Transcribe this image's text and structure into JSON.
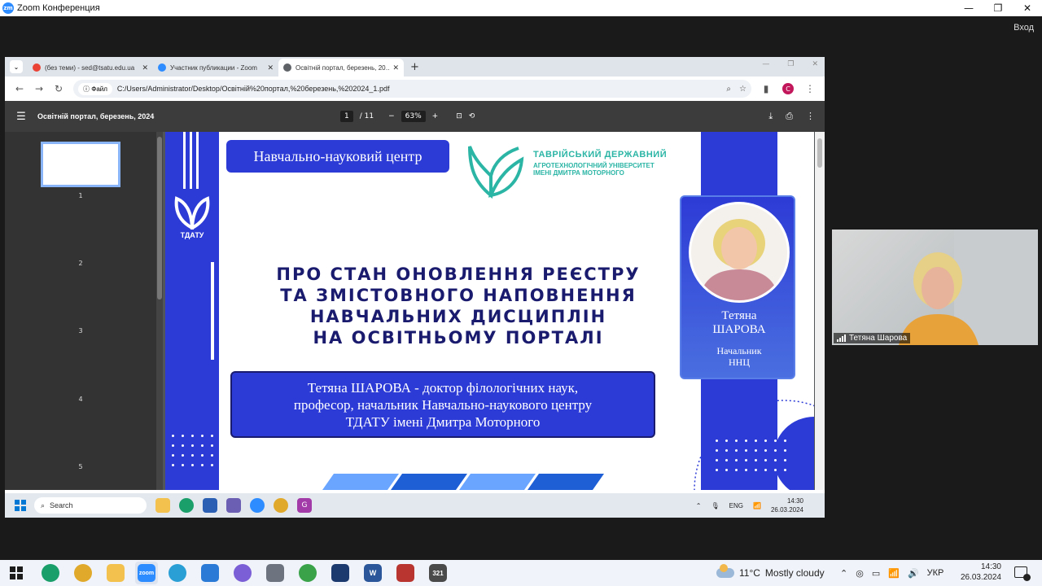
{
  "zoom": {
    "title": "Zoom Конференция",
    "logo": "zm",
    "login_label": "Вход",
    "minimize": "—",
    "maximize": "❐",
    "close": "✕"
  },
  "browser": {
    "tabs": [
      {
        "label": "(без теми) - sed@tsatu.edu.ua",
        "icon": "gmail-icon",
        "color": "#ea4335"
      },
      {
        "label": "Участник публикации - Zoom",
        "icon": "zoom-icon",
        "color": "#2d8cff"
      },
      {
        "label": "Освітній портал, березень, 20…",
        "icon": "globe-icon",
        "color": "#5f6368"
      }
    ],
    "new_tab": "+",
    "file_chip": "Файл",
    "url": "C:/Users/Administrator/Desktop/Освітній%20портал,%20березень,%202024_1.pdf",
    "profile_letter": "C"
  },
  "pdf": {
    "title": "Освітній портал, березень, 2024",
    "page_current": "1",
    "page_total": "/ 11",
    "zoom": "63%",
    "thumbnails": [
      "1",
      "2",
      "3",
      "4",
      "5"
    ]
  },
  "slide": {
    "badge": "Навчально-науковий центр",
    "logo_text": "ТДАТУ",
    "university": {
      "line1": "ТАВРІЙСЬКИЙ ДЕРЖАВНИЙ",
      "line2": "АГРОТЕХНОЛОГІЧНИЙ УНІВЕРСИТЕТ",
      "line3": "ІМЕНІ ДМИТРА МОТОРНОГО"
    },
    "title_lines": [
      "ПРО СТАН ОНОВЛЕННЯ РЕЄСТРУ",
      "ТА ЗМІСТОВНОГО НАПОВНЕННЯ",
      "НАВЧАЛЬНИХ ДИСЦИПЛІН",
      "НА ОСВІТНЬОМУ ПОРТАЛІ"
    ],
    "description_lines": [
      "Тетяна ШАРОВА - доктор філологічних наук,",
      "професор, начальник Навчально-наукового центру",
      "ТДАТУ імені Дмитра Моторного"
    ],
    "person_first": "Тетяна",
    "person_last": "ШАРОВА",
    "person_role1": "Начальник",
    "person_role2": "ННЦ"
  },
  "inner_taskbar": {
    "search": "Search",
    "lang": "ENG",
    "time": "14:30",
    "date": "26.03.2024"
  },
  "participant": {
    "name": "Тетяна Шарова"
  },
  "taskbar": {
    "weather_temp": "11°C",
    "weather_desc": "Mostly cloudy",
    "lang": "УКР",
    "time": "14:30",
    "date": "26.03.2024",
    "app_labels": {
      "zoom": "zoom",
      "word": "W",
      "calendar": "321"
    }
  },
  "colors": {
    "slide_blue": "#2d3bd6",
    "title_navy": "#1a1b6e",
    "uni_teal": "#2bb5a5"
  }
}
